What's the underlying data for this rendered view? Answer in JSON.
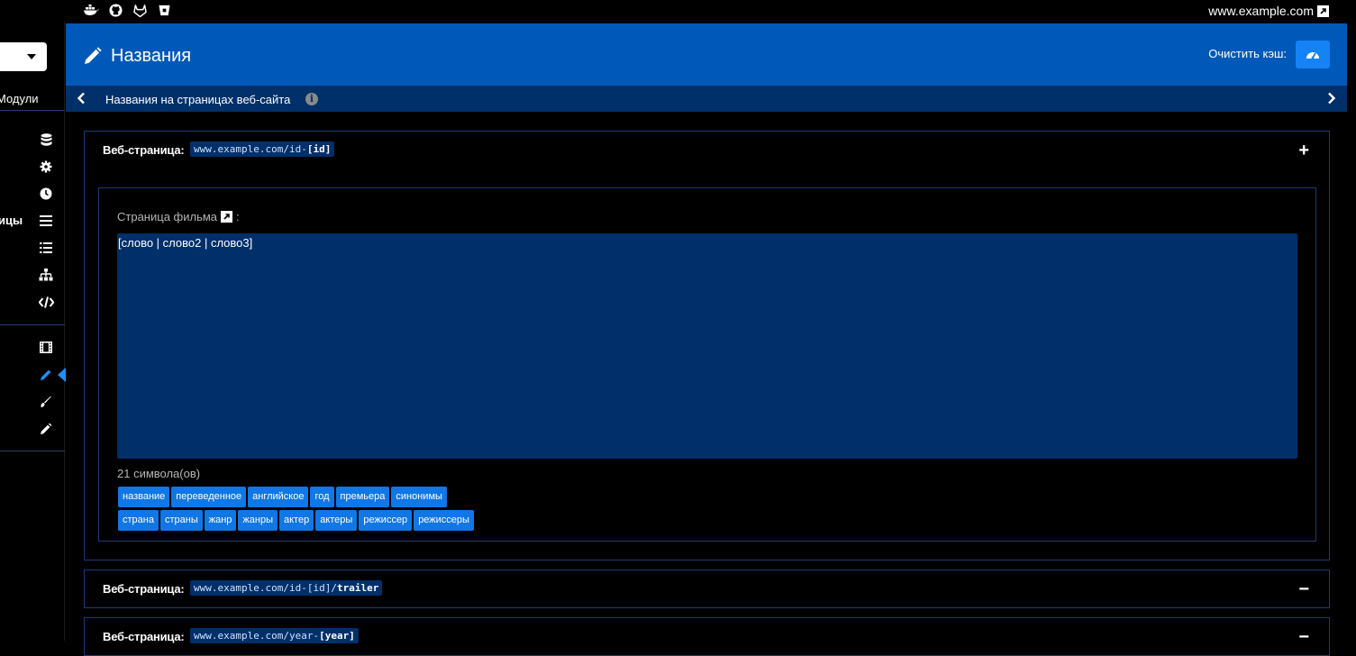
{
  "topbar": {
    "icons": [
      "docker-icon",
      "github-icon",
      "gitlab-icon",
      "bitbucket-icon"
    ],
    "site_link": "www.example.com"
  },
  "sidebar": {
    "modules_label": "Модули",
    "partial_label": "ицы",
    "icons": [
      "database-icon",
      "gear-icon",
      "clock-icon",
      "list-icon",
      "list-ul-icon",
      "sitemap-icon",
      "code-icon",
      "film-icon",
      "pencil-icon",
      "brush-icon",
      "pen-icon"
    ]
  },
  "header": {
    "title": "Названия",
    "cache_label": "Очистить кэш:"
  },
  "subbar": {
    "crumb": "Названия на страницах веб-сайта",
    "info": "i"
  },
  "panels": [
    {
      "label": "Веб-страница:",
      "url_prefix": "www.example.com/id-",
      "url_bold": "[id]",
      "url_suffix": "",
      "toggle": "+",
      "expanded": true,
      "field_label": "Страница фильма",
      "field_colon": ":",
      "value": "[слово | слово2 | слово3]",
      "counter": "21 символа(ов)",
      "tags_row1": [
        "название",
        "переведенное",
        "английское",
        "год",
        "премьера",
        "синонимы"
      ],
      "tags_row2": [
        "страна",
        "страны",
        "жанр",
        "жанры",
        "актер",
        "актеры",
        "режиссер",
        "режиссеры"
      ]
    },
    {
      "label": "Веб-страница:",
      "url_prefix": "www.example.com/id-[id]/",
      "url_bold": "trailer",
      "toggle": "−"
    },
    {
      "label": "Веб-страница:",
      "url_prefix": "www.example.com/year-",
      "url_bold": "[year]",
      "toggle": "−"
    }
  ],
  "colors": {
    "header_bg": "#0059b8",
    "subbar_bg": "#00306a",
    "accent": "#1177e6",
    "panel_border": "#1d3a78"
  }
}
